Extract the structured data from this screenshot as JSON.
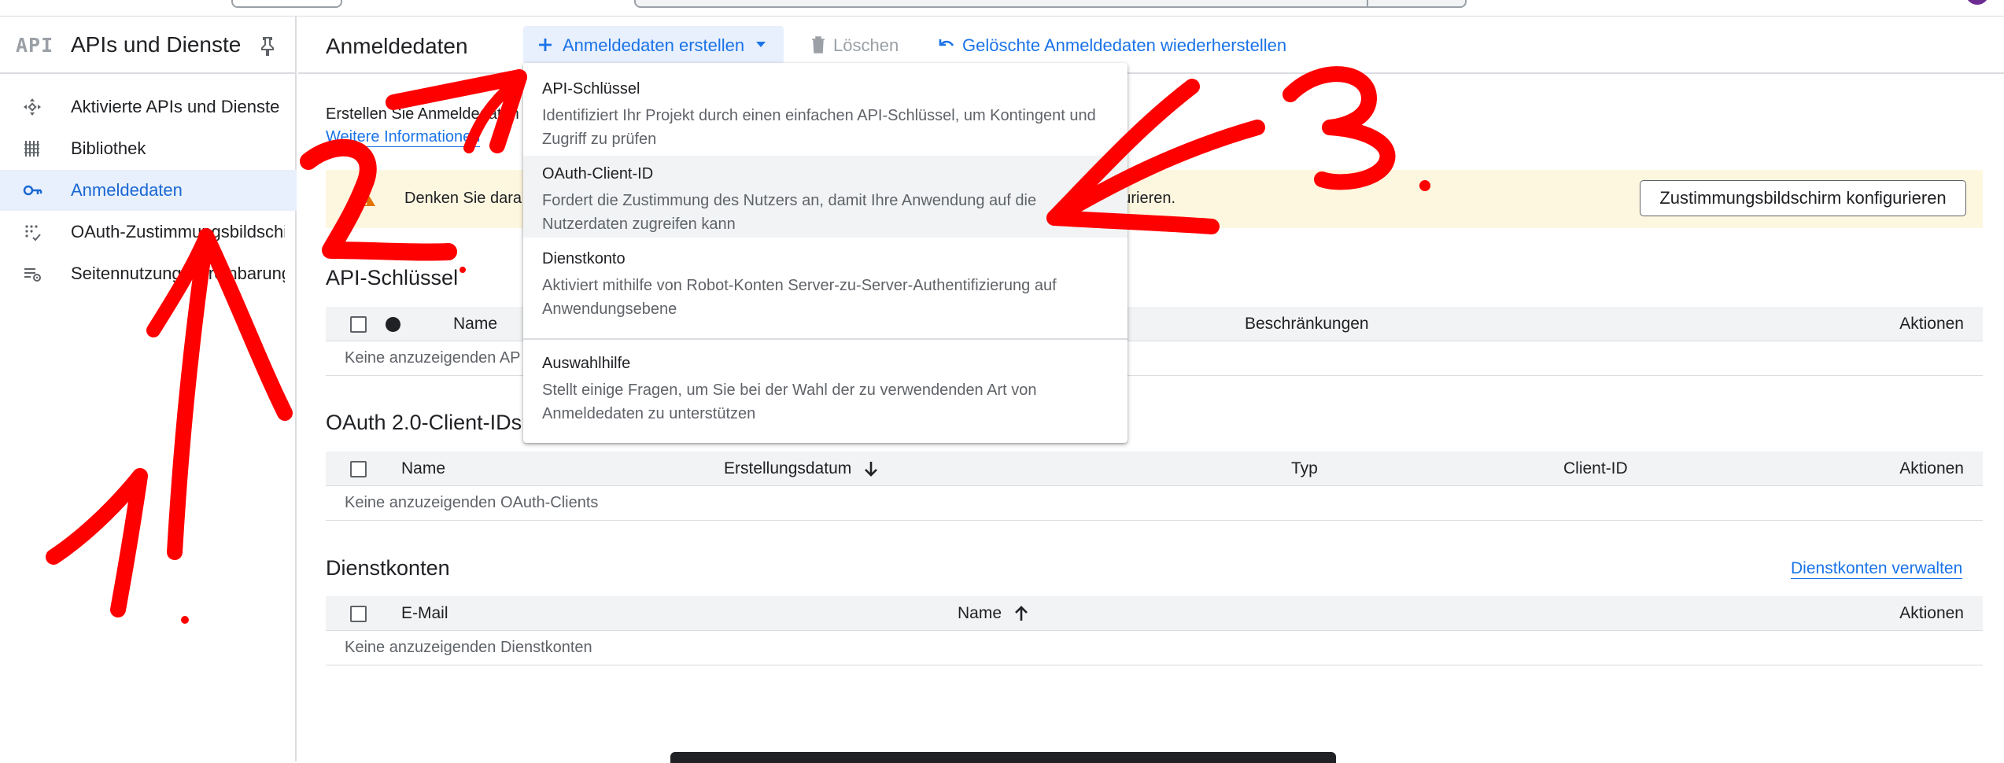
{
  "sidebar": {
    "logo_text": "API",
    "title": "APIs und Dienste",
    "items": [
      {
        "label": "Aktivierte APIs und Dienste",
        "icon": "api-hub-icon",
        "active": false
      },
      {
        "label": "Bibliothek",
        "icon": "library-icon",
        "active": false
      },
      {
        "label": "Anmeldedaten",
        "icon": "key-icon",
        "active": true
      },
      {
        "label": "OAuth-Zustimmungsbildschirm",
        "icon": "consent-screen-icon",
        "active": false
      },
      {
        "label": "Seitennutzungsvereinbarungen",
        "icon": "page-settings-icon",
        "active": false
      }
    ]
  },
  "header": {
    "title": "Anmeldedaten",
    "create_label": "Anmeldedaten erstellen",
    "delete_label": "Löschen",
    "restore_label": "Gelöschte Anmeldedaten wiederherstellen"
  },
  "intro": {
    "text": "Erstellen Sie Anmeldedaten",
    "link": "Weitere Informationen"
  },
  "banner": {
    "text": "Denken Sie dara",
    "text_tail": "nfigurieren.",
    "button": "Zustimmungsbildschirm konfigurieren"
  },
  "dropdown": {
    "items": [
      {
        "title": "API-Schlüssel",
        "desc": "Identifiziert Ihr Projekt durch einen einfachen API-Schlüssel, um Kontingent und Zugriff zu prüfen"
      },
      {
        "title": "OAuth-Client-ID",
        "desc": "Fordert die Zustimmung des Nutzers an, damit Ihre Anwendung auf die Nutzerdaten zugreifen kann"
      },
      {
        "title": "Dienstkonto",
        "desc": "Aktiviert mithilfe von Robot-Konten Server-zu-Server-Authentifizierung auf Anwendungsebene"
      },
      {
        "title": "Auswahlhilfe",
        "desc": "Stellt einige Fragen, um Sie bei der Wahl der zu verwendenden Art von Anmeldedaten zu unterstützen"
      }
    ]
  },
  "api_keys": {
    "title": "API-Schlüssel",
    "columns": [
      "Name",
      "Beschränkungen",
      "Aktionen"
    ],
    "empty": "Keine anzuzeigenden AP"
  },
  "oauth": {
    "title": "OAuth 2.0-Client-IDs",
    "columns": [
      "Name",
      "Erstellungsdatum",
      "Typ",
      "Client-ID",
      "Aktionen"
    ],
    "empty": "Keine anzuzeigenden OAuth-Clients"
  },
  "service_accounts": {
    "title": "Dienstkonten",
    "manage_link": "Dienstkonten verwalten",
    "columns": [
      "E-Mail",
      "Name",
      "Aktionen"
    ],
    "empty": "Keine anzuzeigenden Dienstkonten"
  },
  "colors": {
    "accent": "#1a73e8",
    "active_bg": "#e8f0fe",
    "banner_bg": "#fef7e0",
    "warning": "#e37400",
    "annotation": "#ff0000"
  }
}
